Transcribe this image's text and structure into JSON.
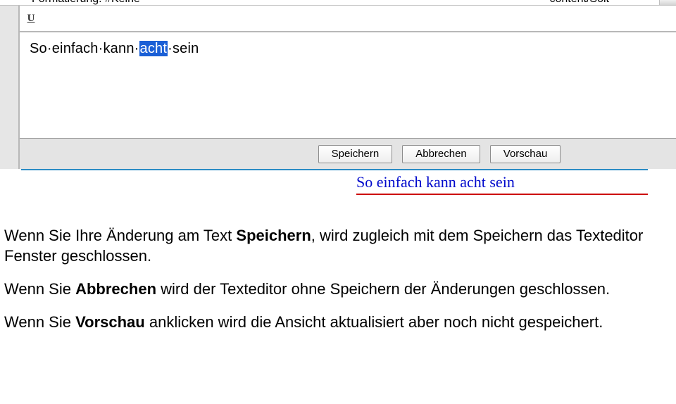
{
  "toolbar": {
    "cutoff_left": "Formatierung:  #Keine",
    "cutoff_right": "content/Soit",
    "underline_tooltip": "U"
  },
  "editor": {
    "text_before": "So·einfach·kann·",
    "text_selected": "acht",
    "text_after": "·sein"
  },
  "buttons": {
    "save": "Speichern",
    "cancel": "Abbrechen",
    "preview": "Vorschau"
  },
  "preview": {
    "headline": "So einfach kann acht sein"
  },
  "doc": {
    "p1_a": "Wenn Sie Ihre Änderung am Text ",
    "p1_b": "Speichern",
    "p1_c": ", wird zugleich mit dem Speichern das Texteditor Fenster geschlossen.",
    "p2_a": "Wenn Sie ",
    "p2_b": "Abbrechen",
    "p2_c": " wird der Texteditor ohne Speichern der Änderungen geschlossen.",
    "p3_a": "Wenn Sie ",
    "p3_b": "Vorschau",
    "p3_c": " anklicken wird die Ansicht aktualisiert aber noch nicht gespeichert."
  }
}
